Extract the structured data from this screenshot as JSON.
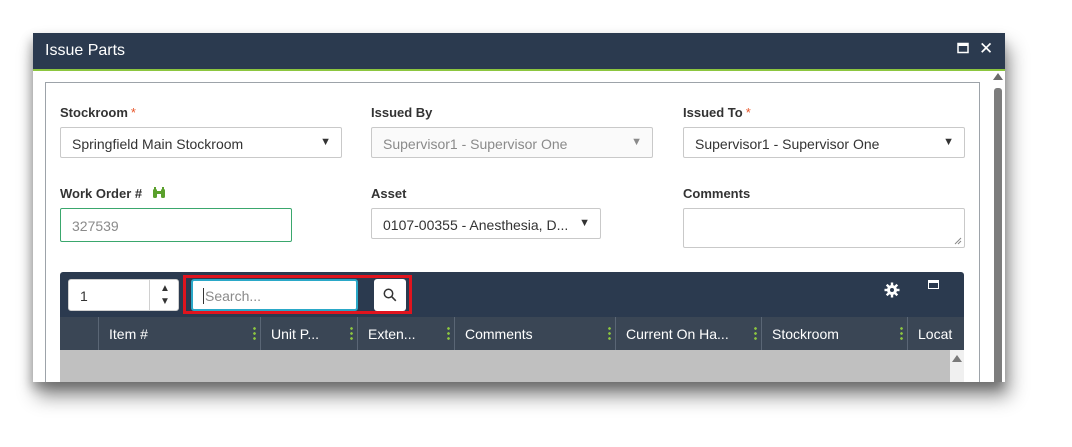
{
  "dialog": {
    "title": "Issue Parts",
    "icons": [
      "maximize-icon",
      "close-icon"
    ]
  },
  "form": {
    "stockroom": {
      "label": "Stockroom",
      "required": "*",
      "value": "Springfield Main Stockroom"
    },
    "issued_by": {
      "label": "Issued By",
      "value": "Supervisor1 - Supervisor One"
    },
    "issued_to": {
      "label": "Issued To",
      "required": "*",
      "value": "Supervisor1 - Supervisor One"
    },
    "work_order": {
      "label": "Work Order #",
      "value": "327539",
      "icon": "binoculars-icon"
    },
    "asset": {
      "label": "Asset",
      "value": "0107-00355 - Anesthesia, D..."
    },
    "comments": {
      "label": "Comments",
      "value": ""
    }
  },
  "toolbar": {
    "quantity": "1",
    "search_placeholder": "Search...",
    "icons": [
      "search-icon",
      "gear-icon",
      "maximize-icon"
    ]
  },
  "grid": {
    "columns": [
      "",
      "Item #",
      "Unit P...",
      "Exten...",
      "Comments",
      "Current On Ha...",
      "Stockroom",
      "Locat"
    ]
  },
  "colors": {
    "titlebar": "#2b3a4f",
    "accent_green": "#8cc63f",
    "highlight_red": "#e0141e",
    "required": "#e8562a"
  }
}
